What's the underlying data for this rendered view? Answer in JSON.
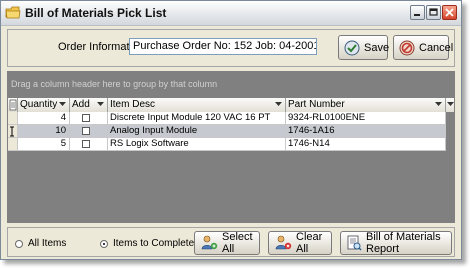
{
  "window": {
    "title": "Bill of Materials Pick List"
  },
  "info": {
    "label": "Order Information:",
    "value": "Purchase Order No: 152 Job: 04-2001"
  },
  "buttons": {
    "save": "Save",
    "cancel": "Cancel",
    "select_all": "Select All",
    "clear_all": "Clear All",
    "bom_report": "Bill of Materials Report"
  },
  "grid": {
    "group_hint": "Drag a column header here to group by that column",
    "columns": [
      "Quantity",
      "Add",
      "Item Desc",
      "Part Number"
    ],
    "rows": [
      {
        "quantity": "4",
        "add": false,
        "item_desc": "Discrete Input Module 120 VAC 16 PT",
        "part_number": "9324-RL0100ENE"
      },
      {
        "quantity": "10",
        "add": false,
        "item_desc": "Analog Input Module",
        "part_number": "1746-1A16"
      },
      {
        "quantity": "5",
        "add": false,
        "item_desc": "RS Logix Software",
        "part_number": "1746-N14"
      }
    ]
  },
  "filter": {
    "all_items": "All Items",
    "items_to_complete": "Items to Complete",
    "selected": "items_to_complete"
  }
}
